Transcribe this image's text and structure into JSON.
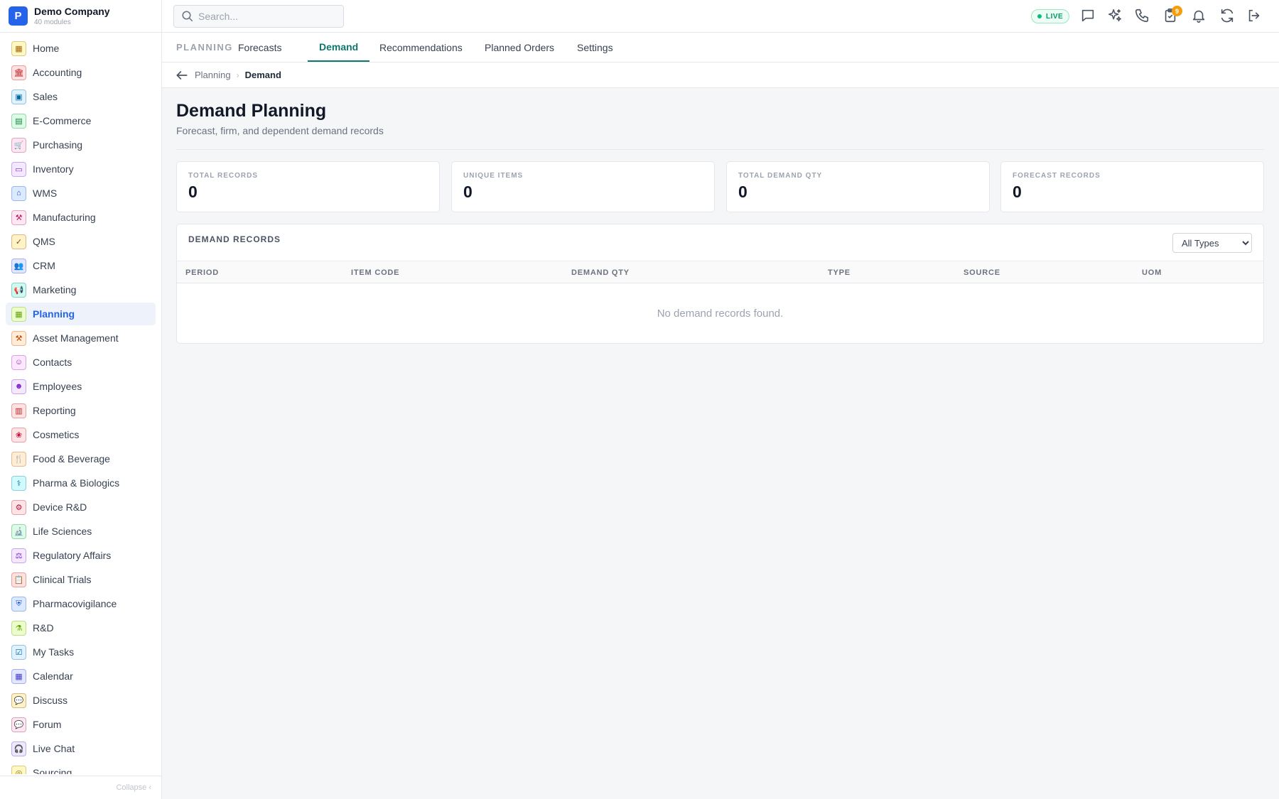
{
  "brand": {
    "initial": "P",
    "name": "Demo Company",
    "subtitle": "40 modules"
  },
  "sidebar": {
    "items": [
      {
        "label": "Home",
        "icon": "grid-icon",
        "glyph": "▦",
        "color": "#a16207",
        "bg": "#fef9c3",
        "active": false
      },
      {
        "label": "Accounting",
        "icon": "bank-icon",
        "glyph": "🏛",
        "color": "#b91c1c",
        "bg": "#fee2e2",
        "active": false
      },
      {
        "label": "Sales",
        "icon": "sales-icon",
        "glyph": "▣",
        "color": "#0369a1",
        "bg": "#e0f2fe",
        "active": false
      },
      {
        "label": "E-Commerce",
        "icon": "store-icon",
        "glyph": "▤",
        "color": "#15803d",
        "bg": "#dcfce7",
        "active": false
      },
      {
        "label": "Purchasing",
        "icon": "cart-icon",
        "glyph": "🛒",
        "color": "#be185d",
        "bg": "#fce7f3",
        "active": false
      },
      {
        "label": "Inventory",
        "icon": "archive-icon",
        "glyph": "▭",
        "color": "#7e22ce",
        "bg": "#f3e8ff",
        "active": false
      },
      {
        "label": "WMS",
        "icon": "warehouse-icon",
        "glyph": "⌂",
        "color": "#1d4ed8",
        "bg": "#dbeafe",
        "active": false
      },
      {
        "label": "Manufacturing",
        "icon": "factory-icon",
        "glyph": "⚒",
        "color": "#be185d",
        "bg": "#fce7f3",
        "active": false
      },
      {
        "label": "QMS",
        "icon": "check-badge-icon",
        "glyph": "✓",
        "color": "#92400e",
        "bg": "#fef3c7",
        "active": false
      },
      {
        "label": "CRM",
        "icon": "people-icon",
        "glyph": "👥",
        "color": "#4338ca",
        "bg": "#e0e7ff",
        "active": false
      },
      {
        "label": "Marketing",
        "icon": "megaphone-icon",
        "glyph": "📢",
        "color": "#0f766e",
        "bg": "#ccfbf1",
        "active": false
      },
      {
        "label": "Planning",
        "icon": "calendar-plan-icon",
        "glyph": "▦",
        "color": "#65a30d",
        "bg": "#ecfccb",
        "active": true
      },
      {
        "label": "Asset Management",
        "icon": "tools-icon",
        "glyph": "⚒",
        "color": "#c2410c",
        "bg": "#ffedd5",
        "active": false
      },
      {
        "label": "Contacts",
        "icon": "contact-card-icon",
        "glyph": "☺",
        "color": "#a21caf",
        "bg": "#fae8ff",
        "active": false
      },
      {
        "label": "Employees",
        "icon": "employee-icon",
        "glyph": "☻",
        "color": "#7e22ce",
        "bg": "#f3e8ff",
        "active": false
      },
      {
        "label": "Reporting",
        "icon": "bar-chart-icon",
        "glyph": "▥",
        "color": "#b91c1c",
        "bg": "#fee2e2",
        "active": false
      },
      {
        "label": "Cosmetics",
        "icon": "lotus-icon",
        "glyph": "❀",
        "color": "#be123c",
        "bg": "#ffe4e6",
        "active": false
      },
      {
        "label": "Food & Beverage",
        "icon": "utensils-icon",
        "glyph": "🍴",
        "color": "#b45309",
        "bg": "#ffedd5",
        "active": false
      },
      {
        "label": "Pharma & Biologics",
        "icon": "pill-bottle-icon",
        "glyph": "⚕",
        "color": "#0e7490",
        "bg": "#cffafe",
        "active": false
      },
      {
        "label": "Device R&D",
        "icon": "device-icon",
        "glyph": "⚙",
        "color": "#be123c",
        "bg": "#ffe4e6",
        "active": false
      },
      {
        "label": "Life Sciences",
        "icon": "microscope-icon",
        "glyph": "🔬",
        "color": "#15803d",
        "bg": "#dcfce7",
        "active": false
      },
      {
        "label": "Regulatory Affairs",
        "icon": "gavel-icon",
        "glyph": "⚖",
        "color": "#7e22ce",
        "bg": "#f3e8ff",
        "active": false
      },
      {
        "label": "Clinical Trials",
        "icon": "clipboard-icon",
        "glyph": "📋",
        "color": "#b91c1c",
        "bg": "#fee2e2",
        "active": false
      },
      {
        "label": "Pharmacovigilance",
        "icon": "shield-icon",
        "glyph": "⛨",
        "color": "#1d4ed8",
        "bg": "#dbeafe",
        "active": false
      },
      {
        "label": "R&D",
        "icon": "flask-icon",
        "glyph": "⚗",
        "color": "#65a30d",
        "bg": "#ecfccb",
        "active": false
      },
      {
        "label": "My Tasks",
        "icon": "checklist-icon",
        "glyph": "☑",
        "color": "#0369a1",
        "bg": "#e0f2fe",
        "active": false
      },
      {
        "label": "Calendar",
        "icon": "calendar-icon",
        "glyph": "▦",
        "color": "#4338ca",
        "bg": "#e0e7ff",
        "active": false
      },
      {
        "label": "Discuss",
        "icon": "chat-bubbles-icon",
        "glyph": "💬",
        "color": "#92400e",
        "bg": "#fef3c7",
        "active": false
      },
      {
        "label": "Forum",
        "icon": "forum-icon",
        "glyph": "💬",
        "color": "#9d174d",
        "bg": "#fce7f3",
        "active": false
      },
      {
        "label": "Live Chat",
        "icon": "headset-icon",
        "glyph": "🎧",
        "color": "#6d28d9",
        "bg": "#ede9fe",
        "active": false
      },
      {
        "label": "Sourcing",
        "icon": "sourcing-icon",
        "glyph": "◎",
        "color": "#a16207",
        "bg": "#fef9c3",
        "active": false
      }
    ],
    "collapse_label": "Collapse ‹"
  },
  "topbar": {
    "search_placeholder": "Search...",
    "live_label": "LIVE",
    "approvals_badge": "9"
  },
  "tabs": {
    "section": "PLANNING",
    "items": [
      {
        "label": "Forecasts",
        "active": false
      },
      {
        "label": "Demand",
        "active": true
      },
      {
        "label": "Recommendations",
        "active": false
      },
      {
        "label": "Planned Orders",
        "active": false
      },
      {
        "label": "Settings",
        "active": false
      }
    ]
  },
  "breadcrumb": {
    "parent": "Planning",
    "current": "Demand"
  },
  "page": {
    "title": "Demand Planning",
    "subtitle": "Forecast, firm, and dependent demand records"
  },
  "stats": [
    {
      "label": "TOTAL RECORDS",
      "value": "0"
    },
    {
      "label": "UNIQUE ITEMS",
      "value": "0"
    },
    {
      "label": "TOTAL DEMAND QTY",
      "value": "0"
    },
    {
      "label": "FORECAST RECORDS",
      "value": "0"
    }
  ],
  "table": {
    "title": "DEMAND RECORDS",
    "filter_options": [
      "All Types"
    ],
    "columns": [
      "PERIOD",
      "ITEM CODE",
      "DEMAND QTY",
      "TYPE",
      "SOURCE",
      "UOM"
    ],
    "empty_message": "No demand records found."
  }
}
